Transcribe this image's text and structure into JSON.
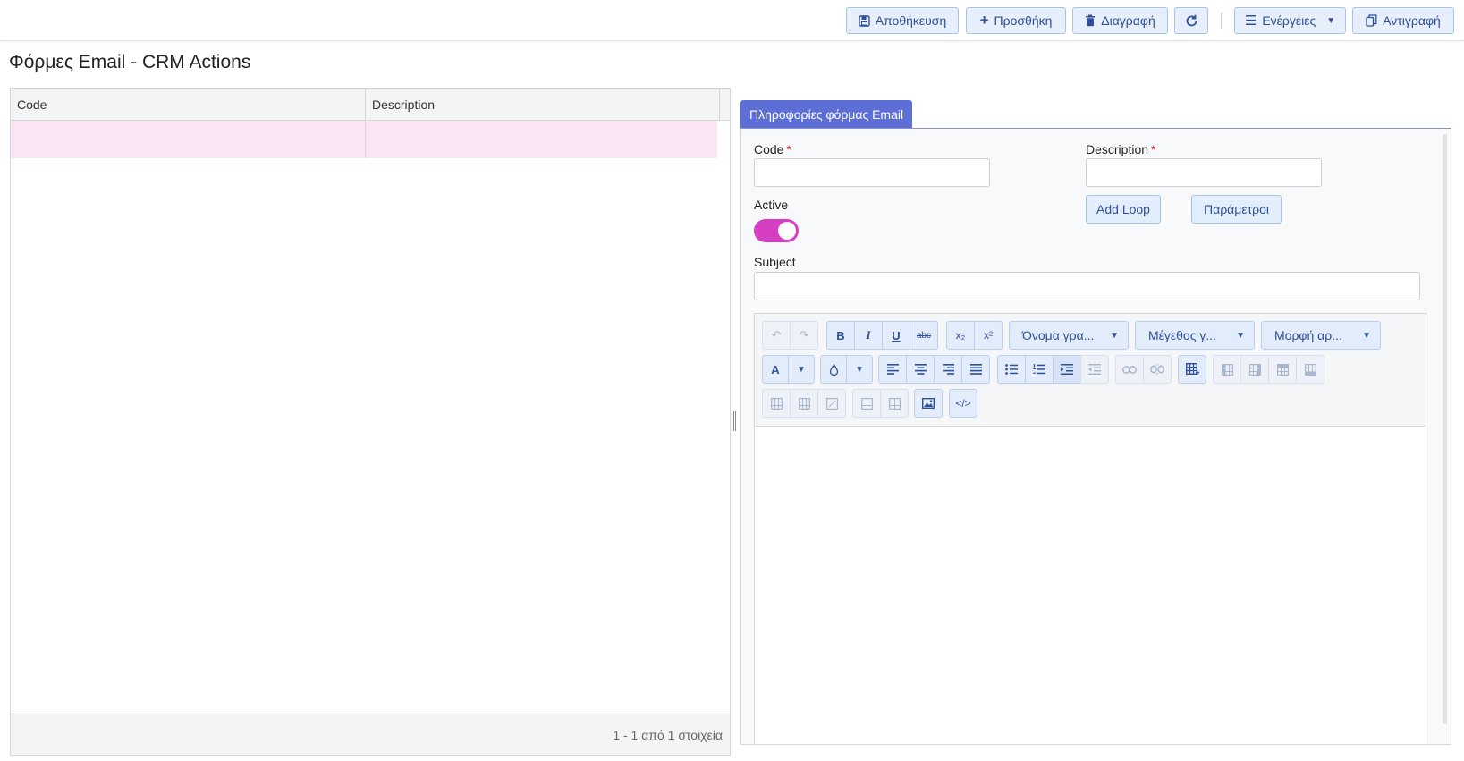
{
  "toolbar": {
    "save": "Αποθήκευση",
    "add": "Προσθήκη",
    "delete": "Διαγραφή",
    "actions": "Ενέργειες",
    "copy": "Αντιγραφή"
  },
  "page": {
    "title": "Φόρμες Email - CRM Actions"
  },
  "grid": {
    "columns": [
      "Code",
      "Description"
    ],
    "rows": [
      {
        "code": "",
        "description": ""
      }
    ],
    "pager_info": "1 - 1 από 1 στοιχεία"
  },
  "form": {
    "tab": "Πληροφορίες φόρμας Email",
    "code_label": "Code",
    "description_label": "Description",
    "active_label": "Active",
    "active": true,
    "subject_label": "Subject",
    "required_mark": "*",
    "add_loop": "Add Loop",
    "params": "Παράμετροι",
    "code_value": "",
    "description_value": "",
    "subject_value": ""
  },
  "editor": {
    "font_name": "Όνομα γρα...",
    "font_size": "Μέγεθος γ...",
    "format": "Μορφή αρ...",
    "content": ""
  },
  "colors": {
    "accent": "#5d6fd6",
    "toggle_on": "#d63fc1",
    "selected_row": "#fbe6f6",
    "button_bg": "#e6effb",
    "button_text": "#2f4f9a"
  }
}
